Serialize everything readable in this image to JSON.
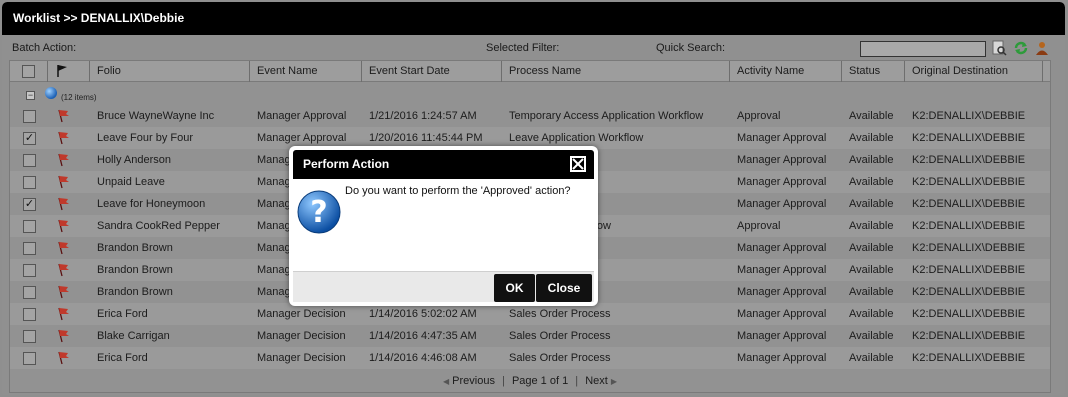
{
  "window": {
    "title": "Worklist >> DENALLIX\\Debbie"
  },
  "toolbar": {
    "batch_action_label": "Batch Action:",
    "selected_filter_label": "Selected Filter:",
    "quick_search_label": "Quick Search:",
    "search_value": "",
    "icons": [
      "search-icon",
      "refresh-icon",
      "user-icon"
    ]
  },
  "columns": [
    "Folio",
    "Event Name",
    "Event Start Date",
    "Process Name",
    "Activity Name",
    "Status",
    "Original Destination"
  ],
  "group": {
    "count_label": "(12 items)"
  },
  "rows": [
    {
      "checked": false,
      "folio": "Bruce WayneWayne Inc",
      "event": "Manager Approval",
      "date": "1/21/2016 1:24:57 AM",
      "process": "Temporary Access Application Workflow",
      "activity": "Approval",
      "status": "Available",
      "dest": "K2:DENALLIX\\DEBBIE"
    },
    {
      "checked": true,
      "folio": "Leave Four by Four",
      "event": "Manager Approval",
      "date": "1/20/2016 11:45:44 PM",
      "process": "Leave Application Workflow",
      "activity": "Manager Approval",
      "status": "Available",
      "dest": "K2:DENALLIX\\DEBBIE"
    },
    {
      "checked": false,
      "folio": "Holly Anderson",
      "event": "Manag",
      "date": "",
      "process": "ss",
      "activity": "Manager Approval",
      "status": "Available",
      "dest": "K2:DENALLIX\\DEBBIE"
    },
    {
      "checked": false,
      "folio": "Unpaid Leave",
      "event": "Manag",
      "date": "",
      "process": "Workflow",
      "activity": "Manager Approval",
      "status": "Available",
      "dest": "K2:DENALLIX\\DEBBIE"
    },
    {
      "checked": true,
      "folio": "Leave for Honeymoon",
      "event": "Manag",
      "date": "",
      "process": "Workflow",
      "activity": "Manager Approval",
      "status": "Available",
      "dest": "K2:DENALLIX\\DEBBIE"
    },
    {
      "checked": false,
      "folio": "Sandra CookRed Pepper",
      "event": "Manag",
      "date": "",
      "process": "Application Workflow",
      "activity": "Approval",
      "status": "Available",
      "dest": "K2:DENALLIX\\DEBBIE"
    },
    {
      "checked": false,
      "folio": "Brandon Brown",
      "event": "Manag",
      "date": "",
      "process": "ss",
      "activity": "Manager Approval",
      "status": "Available",
      "dest": "K2:DENALLIX\\DEBBIE"
    },
    {
      "checked": false,
      "folio": "Brandon Brown",
      "event": "Manag",
      "date": "",
      "process": "ss",
      "activity": "Manager Approval",
      "status": "Available",
      "dest": "K2:DENALLIX\\DEBBIE"
    },
    {
      "checked": false,
      "folio": "Brandon Brown",
      "event": "Manag",
      "date": "",
      "process": "ss",
      "activity": "Manager Approval",
      "status": "Available",
      "dest": "K2:DENALLIX\\DEBBIE"
    },
    {
      "checked": false,
      "folio": "Erica Ford",
      "event": "Manager Decision",
      "date": "1/14/2016 5:02:02 AM",
      "process": "Sales Order Process",
      "activity": "Manager Approval",
      "status": "Available",
      "dest": "K2:DENALLIX\\DEBBIE"
    },
    {
      "checked": false,
      "folio": "Blake Carrigan",
      "event": "Manager Decision",
      "date": "1/14/2016 4:47:35 AM",
      "process": "Sales Order Process",
      "activity": "Manager Approval",
      "status": "Available",
      "dest": "K2:DENALLIX\\DEBBIE"
    },
    {
      "checked": false,
      "folio": "Erica Ford",
      "event": "Manager Decision",
      "date": "1/14/2016 4:46:08 AM",
      "process": "Sales Order Process",
      "activity": "Manager Approval",
      "status": "Available",
      "dest": "K2:DENALLIX\\DEBBIE"
    }
  ],
  "pager": {
    "previous": "Previous",
    "page_info": "Page 1 of 1",
    "next": "Next"
  },
  "dialog": {
    "title": "Perform Action",
    "message": "Do you want to perform the 'Approved' action?",
    "ok_label": "OK",
    "close_label": "Close",
    "icon": "question-icon"
  },
  "colors": {
    "titlebar": "#000000",
    "grid_bg": "#929292",
    "flag": "#c0392b",
    "refresh": "#2e9b3b"
  }
}
